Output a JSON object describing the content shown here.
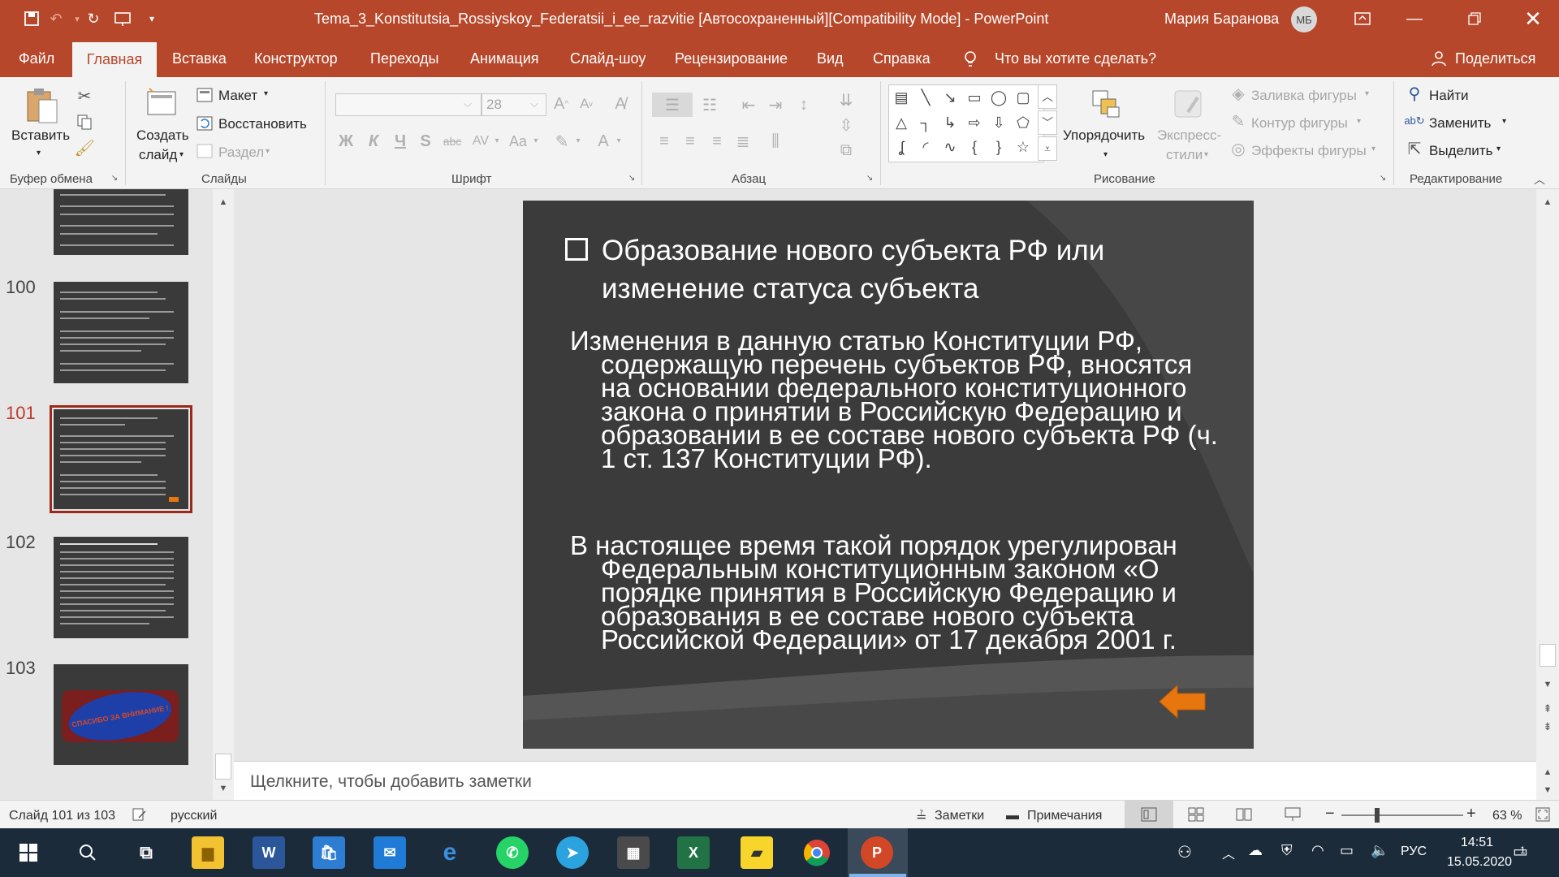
{
  "colors": {
    "accent": "#b7472a",
    "slide_bg": "#3b3b3b",
    "arrow": "#e8760f",
    "taskbar": "#1c2b3a"
  },
  "titlebar": {
    "title": "Tema_3_Konstitutsia_Rossiyskoy_Federatsii_i_ee_razvitie [Автосохраненный][Compatibility Mode]  -  PowerPoint",
    "user": "Мария Баранова",
    "initials": "МБ"
  },
  "tabs": {
    "file": "Файл",
    "home": "Главная",
    "insert": "Вставка",
    "design": "Конструктор",
    "transitions": "Переходы",
    "animation": "Анимация",
    "slideshow": "Слайд-шоу",
    "review": "Рецензирование",
    "view": "Вид",
    "help": "Справка",
    "tell_me": "Что вы хотите сделать?",
    "share": "Поделиться"
  },
  "ribbon": {
    "clipboard": {
      "paste": "Вставить",
      "label": "Буфер обмена"
    },
    "slides": {
      "new_slide_1": "Создать",
      "new_slide_2": "слайд",
      "layout": "Макет",
      "reset": "Восстановить",
      "section": "Раздел",
      "label": "Слайды"
    },
    "font": {
      "size": "28",
      "bold": "Ж",
      "italic": "К",
      "underline": "Ч",
      "shadow": "S",
      "strike": "abc",
      "spacing": "AV",
      "case": "Aa",
      "color": "A",
      "label": "Шрифт"
    },
    "paragraph": {
      "label": "Абзац"
    },
    "drawing": {
      "arrange": "Упорядочить",
      "styles_1": "Экспресс-",
      "styles_2": "стили",
      "fill": "Заливка фигуры",
      "outline": "Контур фигуры",
      "effects": "Эффекты фигуры",
      "label": "Рисование"
    },
    "editing": {
      "find": "Найти",
      "replace": "Заменить",
      "select": "Выделить",
      "label": "Редактирование"
    }
  },
  "thumbnails": [
    {
      "num": "",
      "selected": false
    },
    {
      "num": "100",
      "selected": false
    },
    {
      "num": "101",
      "selected": true
    },
    {
      "num": "102",
      "selected": false
    },
    {
      "num": "103",
      "selected": false,
      "text": "СПАСИБО ЗА ВНИМАНИЕ !"
    }
  ],
  "slide": {
    "title": "Образование нового субъекта РФ или изменение статуса субъекта",
    "para1": "Изменения в данную статью Конституции РФ, содержащую перечень субъектов РФ, вносятся на основании федерального конституционного закона о принятии в Российскую Федерацию и образовании в ее составе нового субъекта РФ (ч. 1 ст. 137 Конституции РФ).",
    "para2": "В настоящее время такой порядок урегулирован Федеральным конституционным законом «О порядке принятия в Российскую Федерацию и образования в ее составе нового субъекта Российской Федерации» от 17 декабря 2001 г."
  },
  "notes": {
    "placeholder": "Щелкните, чтобы добавить заметки"
  },
  "status": {
    "slide_info": "Слайд 101 из 103",
    "language": "русский",
    "notes_btn": "Заметки",
    "comments_btn": "Примечания",
    "zoom": "63 %"
  },
  "taskbar": {
    "lang": "РУС",
    "time": "14:51",
    "date": "15.05.2020",
    "notifications": "1"
  }
}
